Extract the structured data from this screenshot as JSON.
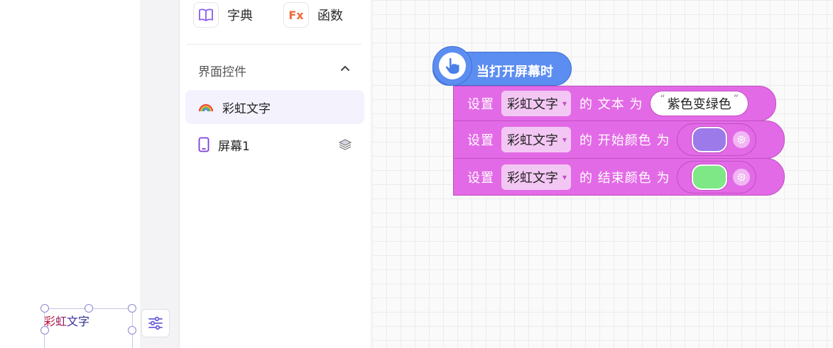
{
  "preview": {
    "rainbow_chars": [
      "彩",
      "虹",
      "文",
      "字"
    ]
  },
  "tools": {
    "dictionary_label": "字典",
    "functions_label": "函数",
    "functions_icon_text": "Fx"
  },
  "section": {
    "title": "界面控件"
  },
  "components": [
    {
      "label": "彩虹文字",
      "icon": "rainbow-icon",
      "selected": true
    },
    {
      "label": "屏幕1",
      "icon": "phone-icon",
      "selected": false
    }
  ],
  "blocks": {
    "event_label": "当打开屏幕时",
    "statements": [
      {
        "prefix": "设置",
        "component": "彩虹文字",
        "suffix": "的 文本 为",
        "value": "紫色变绿色"
      },
      {
        "prefix": "设置",
        "component": "彩虹文字",
        "suffix": "的 开始颜色 为",
        "color": "#9c7aea"
      },
      {
        "prefix": "设置",
        "component": "彩虹文字",
        "suffix": "的 结束颜色 为",
        "color": "#7ee886"
      }
    ]
  },
  "colors": {
    "event_block": "#5c8df0",
    "statement_block": "#e36ae6",
    "accent": "#7b6fdc"
  }
}
